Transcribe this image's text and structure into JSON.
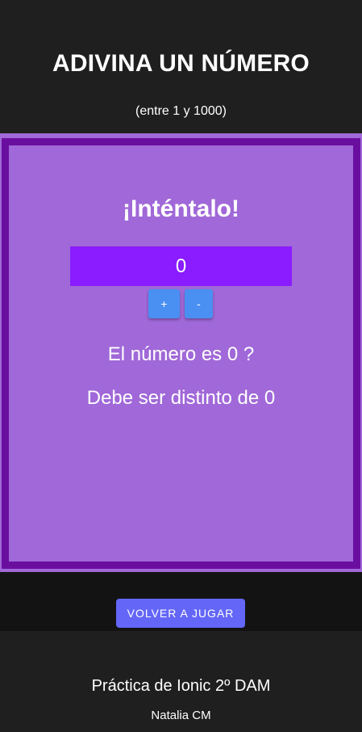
{
  "header": {
    "title": "ADIVINA UN NÚMERO",
    "subtitle": "(entre 1 y 1000)"
  },
  "game": {
    "heading": "¡Inténtalo!",
    "current_value": "0",
    "plus_label": "+",
    "minus_label": "-",
    "question": "El número es 0 ?",
    "hint": "Debe ser distinto de 0"
  },
  "actions": {
    "replay_label": "VOLVER A JUGAR"
  },
  "footer": {
    "title": "Práctica de Ionic 2º DAM",
    "author": "Natalia CM"
  },
  "colors": {
    "background": "#1f1f1f",
    "game_bg": "#a068d8",
    "game_border": "#6a0ea0",
    "number_bg": "#8a1cff",
    "step_button": "#4a8ff2",
    "replay_button": "#6366f7"
  }
}
